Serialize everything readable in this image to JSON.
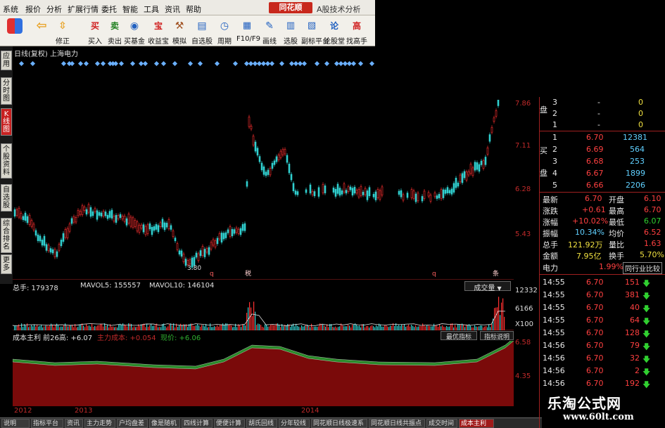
{
  "menu": {
    "items": [
      "系统",
      "报价",
      "分析",
      "扩展行情",
      "委托",
      "智能",
      "工具",
      "资讯",
      "帮助"
    ],
    "brand": "同花顺",
    "app_title": "A股技术分析"
  },
  "toolbar": {
    "buttons": [
      {
        "label": "",
        "icon": "grid-icon"
      },
      {
        "label": "",
        "icon": "back-arrow-icon"
      },
      {
        "label": "修正",
        "icon": "up-down-arrow-icon"
      },
      {
        "label": "买入",
        "icon": "buy-icon",
        "glyph": "买"
      },
      {
        "label": "卖出",
        "icon": "sell-icon",
        "glyph": "卖"
      },
      {
        "label": "买基金",
        "icon": "fund-icon"
      },
      {
        "label": "收益宝",
        "icon": "treasure-icon",
        "glyph": "宝"
      },
      {
        "label": "模拟",
        "icon": "hammer-icon"
      },
      {
        "label": "自选股",
        "icon": "watchlist-icon"
      },
      {
        "label": "周期",
        "icon": "clock-icon"
      },
      {
        "label": "F10/F9",
        "icon": "f10-icon"
      },
      {
        "label": "画线",
        "icon": "pencil-icon"
      },
      {
        "label": "选股",
        "icon": "filter-icon"
      },
      {
        "label": "副标平台",
        "icon": "platform-icon"
      },
      {
        "label": "论股堂",
        "icon": "discussion-icon",
        "glyph": "论"
      },
      {
        "label": "找高手",
        "icon": "expert-icon",
        "glyph": "高"
      }
    ]
  },
  "sidetabs": [
    {
      "label": "应用",
      "active": false
    },
    {
      "label": "分时图",
      "active": false
    },
    {
      "label": "K线图",
      "active": true
    },
    {
      "label": "个股资料",
      "active": false
    },
    {
      "label": "自选股",
      "active": false
    },
    {
      "label": "综合排名",
      "active": false
    },
    {
      "label": "更多",
      "active": false
    }
  ],
  "chart_title": "日线(复权) 上海电力",
  "main_chart": {
    "y_ticks": [
      "7.86",
      "7.11",
      "6.28",
      "5.43"
    ],
    "low_marker": "3.80",
    "event_markers": [
      "q",
      "税",
      "q",
      "条"
    ]
  },
  "volume": {
    "header_total": "总手: 179378",
    "header_ma5": "MAVOL5: 155557",
    "header_ma10": "MAVOL10: 146104",
    "dropdown": "成交量",
    "y_ticks": [
      "12332",
      "6166",
      "X100"
    ]
  },
  "cost": {
    "header_name": "成本主利 前26高: +6.07",
    "header_main": "主力成本: +0.054",
    "header_price": "现价: +6.06",
    "btn_best": "最优指标",
    "btn_help": "指标说明",
    "y_ticks": [
      "6.58",
      "4.35"
    ]
  },
  "date_axis": [
    "2012",
    "2013",
    "2014"
  ],
  "bottom_tabs": [
    {
      "label": "说明",
      "active": false
    },
    {
      "label": "指标平台",
      "active": false
    },
    {
      "label": "资讯",
      "active": false
    },
    {
      "label": "主力走势",
      "active": false
    },
    {
      "label": "户均盘差",
      "active": false
    },
    {
      "label": "像是随机",
      "active": false
    },
    {
      "label": "四线计算",
      "active": false
    },
    {
      "label": "便便计算",
      "active": false
    },
    {
      "label": "胡氏回线",
      "active": false
    },
    {
      "label": "分年较线",
      "active": false
    },
    {
      "label": "同花顺日线极速系",
      "active": false
    },
    {
      "label": "同花顺日线共振点",
      "active": false
    },
    {
      "label": "成交时间",
      "active": false
    },
    {
      "label": "成本主利",
      "active": true
    }
  ],
  "right_panel": {
    "sell_rows": [
      {
        "lvl": "3",
        "price": "-",
        "vol": "0"
      },
      {
        "lvl": "2",
        "price": "-",
        "vol": "0"
      },
      {
        "lvl": "1",
        "price": "-",
        "vol": "0"
      }
    ],
    "sell_tag": "盘",
    "buy_rows": [
      {
        "lvl": "1",
        "price": "6.70",
        "vol": "12381"
      },
      {
        "lvl": "2",
        "price": "6.69",
        "vol": "564"
      },
      {
        "lvl": "3",
        "price": "6.68",
        "vol": "253"
      },
      {
        "lvl": "4",
        "price": "6.67",
        "vol": "1899"
      },
      {
        "lvl": "5",
        "price": "6.66",
        "vol": "2206"
      }
    ],
    "buy_tag_top": "买",
    "buy_tag_bottom": "盘",
    "stats": [
      {
        "k1": "最新",
        "v1": "6.70",
        "k2": "开盘",
        "v2": "6.10"
      },
      {
        "k1": "涨跌",
        "v1": "+0.61",
        "k2": "最高",
        "v2": "6.70"
      },
      {
        "k1": "涨幅",
        "v1": "+10.02%",
        "k2": "最低",
        "v2": "6.07"
      },
      {
        "k1": "振幅",
        "v1": "10.34%",
        "k2": "均价",
        "v2": "6.52"
      },
      {
        "k1": "总手",
        "v1": "121.92万",
        "k2": "量比",
        "v2": "1.63"
      },
      {
        "k1": "金额",
        "v1": "7.95亿",
        "k2": "换手",
        "v2": "5.70%"
      }
    ],
    "industry": {
      "name": "电力",
      "pct": "1.99%",
      "compare": "同行业比较"
    },
    "ticks": [
      {
        "t": "14:55",
        "p": "6.70",
        "v": "151"
      },
      {
        "t": "14:55",
        "p": "6.70",
        "v": "381"
      },
      {
        "t": "14:55",
        "p": "6.70",
        "v": "40"
      },
      {
        "t": "14:55",
        "p": "6.70",
        "v": "64"
      },
      {
        "t": "14:55",
        "p": "6.70",
        "v": "128"
      },
      {
        "t": "14:56",
        "p": "6.70",
        "v": "79"
      },
      {
        "t": "14:56",
        "p": "6.70",
        "v": "32"
      },
      {
        "t": "14:56",
        "p": "6.70",
        "v": "2"
      },
      {
        "t": "14:56",
        "p": "6.70",
        "v": "192"
      },
      {
        "t": "14:56",
        "p": "6.70",
        "v": "104"
      }
    ]
  },
  "watermark": {
    "line1": "乐淘公式网",
    "line2": "www.60lt.com"
  }
}
